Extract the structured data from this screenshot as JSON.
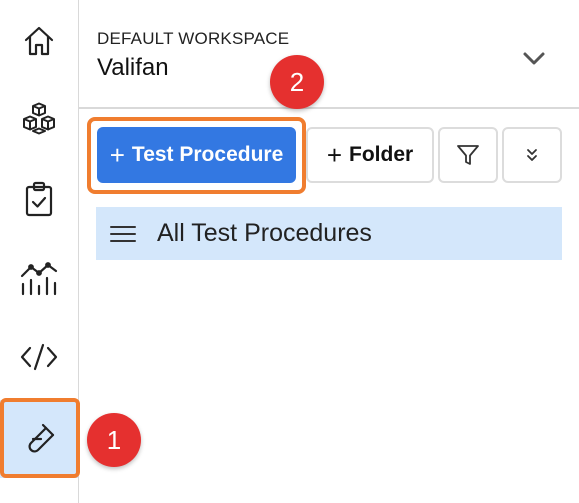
{
  "sidebar": {
    "items": [
      {
        "name": "home",
        "icon": "home-icon",
        "active": false
      },
      {
        "name": "modules",
        "icon": "cubes-icon",
        "active": false
      },
      {
        "name": "tasks",
        "icon": "clipboard-check-icon",
        "active": false
      },
      {
        "name": "analytics",
        "icon": "chart-icon",
        "active": false
      },
      {
        "name": "code",
        "icon": "code-icon",
        "active": false
      },
      {
        "name": "test",
        "icon": "test-tube-icon",
        "active": true
      }
    ]
  },
  "workspace": {
    "label": "DEFAULT WORKSPACE",
    "name": "Valifan"
  },
  "toolbar": {
    "new_procedure_label": "Test Procedure",
    "new_folder_label": "Folder",
    "plus_symbol": "+"
  },
  "tree": {
    "root_label": "All Test Procedures"
  },
  "annotations": {
    "step1": "1",
    "step2": "2"
  },
  "colors": {
    "accent": "#3378e2",
    "highlight": "#f07d2f",
    "badge": "#e5302f",
    "selected_bg": "#d4e7fb"
  }
}
